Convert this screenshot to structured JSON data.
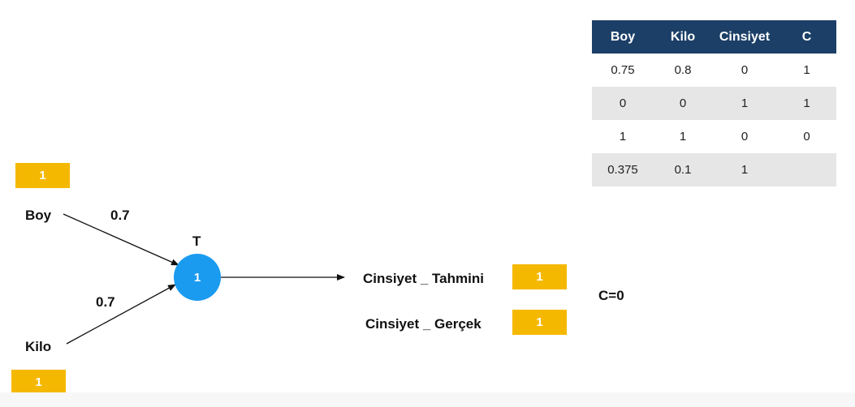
{
  "inputs": {
    "boy": {
      "label": "Boy",
      "value": "1",
      "weight": "0.7"
    },
    "kilo": {
      "label": "Kilo",
      "value": "1",
      "weight": "0.7"
    }
  },
  "node": {
    "label": "T",
    "value": "1"
  },
  "outputs": {
    "tahmini": {
      "label": "Cinsiyet _ Tahmini",
      "value": "1"
    },
    "gercek": {
      "label": "Cinsiyet _ Gerçek",
      "value": "1"
    }
  },
  "condition": "C=0",
  "table": {
    "headers": [
      "Boy",
      "Kilo",
      "Cinsiyet",
      "C"
    ],
    "rows": [
      [
        "0.75",
        "0.8",
        "0",
        "1"
      ],
      [
        "0",
        "0",
        "1",
        "1"
      ],
      [
        "1",
        "1",
        "0",
        "0"
      ],
      [
        "0.375",
        "0.1",
        "1",
        ""
      ]
    ]
  },
  "colors": {
    "badge": "#f5b800",
    "node": "#1a9bf0",
    "table_header": "#1c3f67",
    "row_alt": "#e6e6e6"
  }
}
